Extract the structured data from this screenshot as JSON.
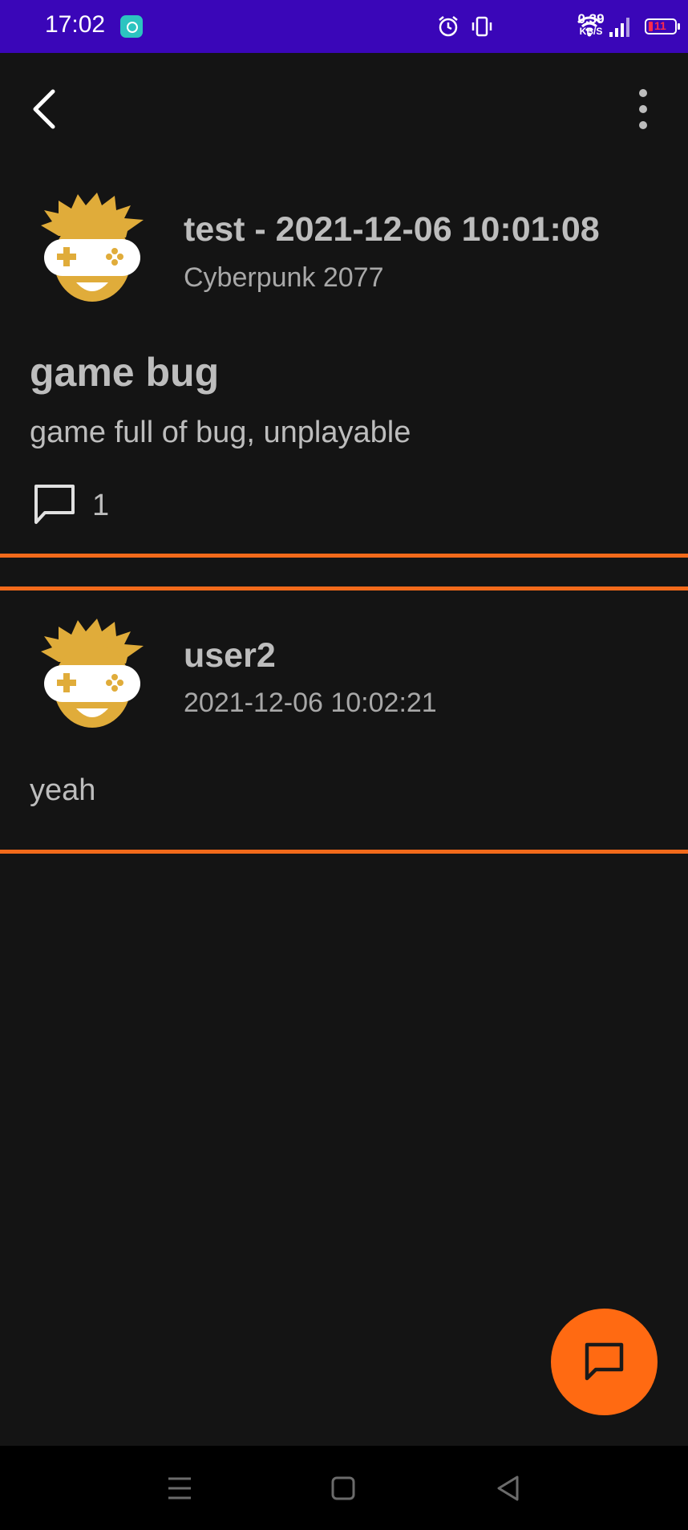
{
  "status_bar": {
    "time": "17:02",
    "net_speed_value": "0.39",
    "net_speed_unit": "KB/S",
    "battery_level": "11",
    "icons": [
      "app-notification-icon",
      "alarm-icon",
      "vibrate-icon",
      "wifi-icon",
      "signal-icon",
      "battery-icon"
    ]
  },
  "topbar": {
    "back_icon": "chevron-left-icon",
    "menu_icon": "more-vertical-icon"
  },
  "post": {
    "author_line": "test - 2021-12-06 10:01:08",
    "game": "Cyberpunk 2077",
    "title": "game bug",
    "body": "game full of bug, unplayable",
    "comment_count": "1"
  },
  "comments": [
    {
      "author": "user2",
      "timestamp": "2021-12-06 10:02:21",
      "body": "yeah"
    }
  ],
  "fab": {
    "icon": "comment-icon"
  },
  "nav_bar": {
    "icons": [
      "recents-icon",
      "home-icon",
      "back-triangle-icon"
    ]
  },
  "colors": {
    "status_bar": "#3a06b8",
    "background": "#141414",
    "accent": "#f26a1b",
    "fab": "#ff6a12",
    "avatar": "#e0ac3a"
  }
}
